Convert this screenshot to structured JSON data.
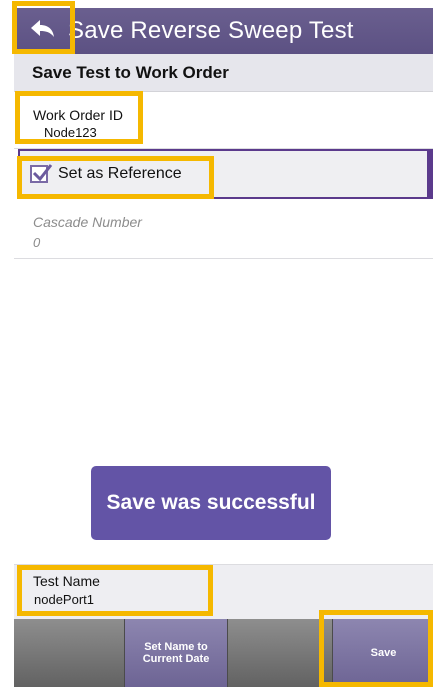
{
  "header": {
    "title": "Save Reverse Sweep Test",
    "back_icon": "back-arrow-icon"
  },
  "section": {
    "title": "Save Test to Work Order"
  },
  "fields": {
    "work_order_label": "Work Order ID",
    "work_order_value": "Node123",
    "reference_label": "Set as Reference",
    "reference_checked": true,
    "cascade_label": "Cascade Number",
    "cascade_value": "0",
    "test_name_label": "Test Name",
    "test_name_value": "nodePort1"
  },
  "toast": {
    "message": "Save was successful"
  },
  "buttons": {
    "set_date_line1": "Set Name to",
    "set_date_line2": "Current Date",
    "save": "Save"
  },
  "colors": {
    "titlebar": "#5f548a",
    "accent": "#6354a6",
    "highlight": "#f5b800",
    "reference_border": "#5b3a8c"
  }
}
